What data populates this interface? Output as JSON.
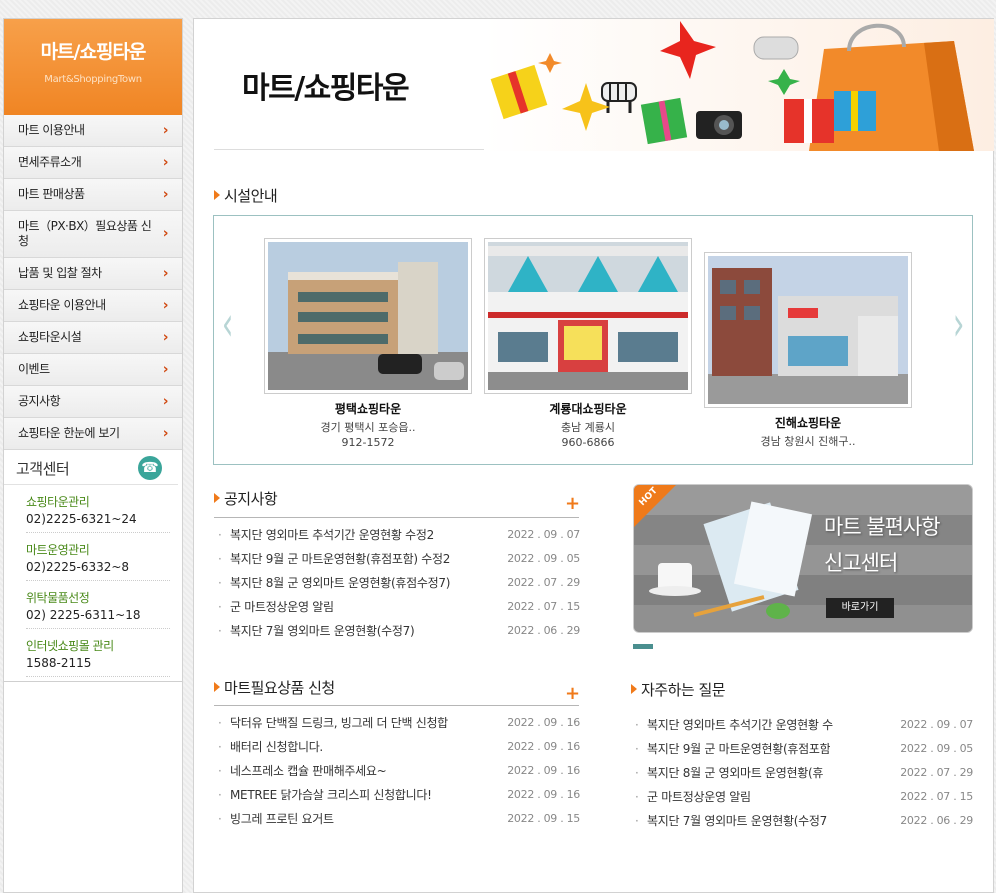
{
  "sidebar": {
    "brand_title": "마트/쇼핑타운",
    "brand_subtitle": "Mart&ShoppingTown",
    "menu": [
      "마트 이용안내",
      "면세주류소개",
      "마트 판매상품",
      "마트（PX·BX）필요상품 신청",
      "납품 및 입찰 절차",
      "쇼핑타운 이용안내",
      "쇼핑타운시설",
      "이벤트",
      "공지사항",
      "쇼핑타운 한눈에 보기"
    ],
    "chevron": "›",
    "customer_center": {
      "title": "고객센터",
      "items": [
        {
          "name": "쇼핑타운관리",
          "tel": "02)2225-6321~24"
        },
        {
          "name": "마트운영관리",
          "tel": "02)2225-6332~8"
        },
        {
          "name": "위탁물품선정",
          "tel": "02) 2225-6311~18"
        },
        {
          "name": "인터넷쇼핑몰 관리",
          "tel": "1588-2115"
        }
      ]
    }
  },
  "main": {
    "page_title": "마트/쇼핑타운",
    "facility": {
      "title": "시설안내",
      "cards": [
        {
          "name": "평택쇼핑타운",
          "addr": "경기 평택시 포승읍..",
          "tel": "912-1572"
        },
        {
          "name": "계룡대쇼핑타운",
          "addr": "충남 계룡시",
          "tel": "960-6866"
        },
        {
          "name": "진해쇼핑타운",
          "addr": "경남 창원시 진해구..",
          "tel": ""
        }
      ]
    },
    "notice": {
      "title": "공지사항",
      "plus": "+",
      "items": [
        {
          "text": "복지단 영외마트 추석기간 운영현황 수정2",
          "date": "2022 . 09 . 07"
        },
        {
          "text": "복지단 9월 군 마트운영현황(휴점포함) 수정2",
          "date": "2022 . 09 . 05"
        },
        {
          "text": "복지단 8월 군 영외마트 운영현황(휴점수정7)",
          "date": "2022 . 07 . 29"
        },
        {
          "text": "군 마트정상운영 알림",
          "date": "2022 . 07 . 15"
        },
        {
          "text": "복지단 7월 영외마트 운영현황(수정7)",
          "date": "2022 . 06 . 29"
        }
      ]
    },
    "request": {
      "title": "마트필요상품 신청",
      "plus": "+",
      "items": [
        {
          "text": "닥터유 단백질 드링크, 빙그레 더 단백 신청합",
          "date": "2022 . 09 . 16"
        },
        {
          "text": "배터리 신청합니다.",
          "date": "2022 . 09 . 16"
        },
        {
          "text": "네스프레소 캡슐 판매해주세요~",
          "date": "2022 . 09 . 16"
        },
        {
          "text": "METREE 닭가슴살 크리스피 신청합니다!",
          "date": "2022 . 09 . 16"
        },
        {
          "text": "빙그레 프로틴 요거트",
          "date": "2022 . 09 . 15"
        }
      ]
    },
    "faq": {
      "title": "자주하는 질문",
      "items": [
        {
          "text": "복지단 영외마트 추석기간 운영현황 수",
          "date": "2022 . 09 . 07"
        },
        {
          "text": "복지단 9월 군 마트운영현황(휴점포함",
          "date": "2022 . 09 . 05"
        },
        {
          "text": "복지단 8월 군 영외마트 운영현황(휴",
          "date": "2022 . 07 . 29"
        },
        {
          "text": "군 마트정상운영 알림",
          "date": "2022 . 07 . 15"
        },
        {
          "text": "복지단 7월 영외마트 운영현황(수정7",
          "date": "2022 . 06 . 29"
        }
      ]
    },
    "promo": {
      "badge": "HOT",
      "title_line1": "마트 불편사항",
      "title_line2": "신고센터",
      "button": "바로가기"
    }
  },
  "colors": {
    "accent_orange": "#f08524",
    "teal": "#4a8f8f",
    "green_text": "#4a8a1a"
  }
}
